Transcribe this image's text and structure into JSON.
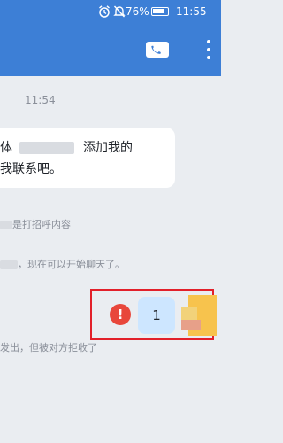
{
  "status_bar": {
    "battery_percent": "76%",
    "time": "11:55",
    "icons": [
      "alarm-icon",
      "mute-icon",
      "battery-icon"
    ]
  },
  "header": {
    "actions": [
      "video-call-icon",
      "more-icon"
    ]
  },
  "chat": {
    "timestamp": "11:54",
    "incoming": {
      "line1_prefix": "体",
      "line1_suffix": "添加我的",
      "line2": "我联系吧。"
    },
    "system_1": "是打招呼内容",
    "system_2": "，现在可以开始聊天了。",
    "outgoing": {
      "text": "1",
      "status": "failed"
    },
    "system_3": "发出，但被对方拒收了"
  },
  "colors": {
    "header": "#3d7fd6",
    "background": "#eaedf1",
    "outgoing_bubble": "#cde6ff",
    "error": "#e8473b",
    "highlight_box": "#e2202a"
  }
}
